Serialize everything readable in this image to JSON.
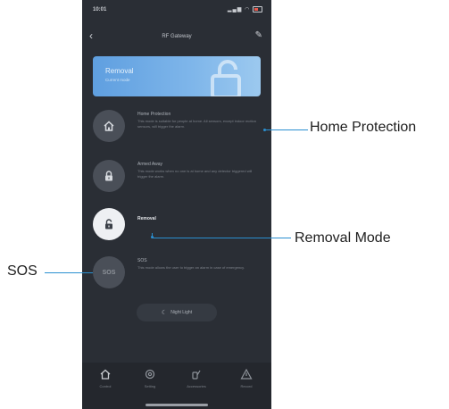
{
  "status_bar": {
    "time": "10:01"
  },
  "nav": {
    "title": "RF Gateway"
  },
  "banner": {
    "title": "Removal",
    "subtitle": "Current mode"
  },
  "modes": [
    {
      "title": "Home Protection",
      "description": "This mode is suitable for people at home. All sensors, except indoor motion sensors, will trigger the alarm."
    },
    {
      "title": "Armed Away",
      "description": "This mode works when no one is at home and any detector triggered will trigger the alarm."
    },
    {
      "title": "Removal",
      "description": ""
    },
    {
      "icon_text": "SOS",
      "title": "SOS",
      "description": "This mode allows the user to trigger an alarm in case of emergency."
    }
  ],
  "night_light": {
    "label": "Night Light"
  },
  "tabs": [
    {
      "label": "Control"
    },
    {
      "label": "Setting"
    },
    {
      "label": "Accessories"
    },
    {
      "label": "Record"
    }
  ],
  "callouts": {
    "home_protection": "Home Protection",
    "removal_mode": "Removal Mode",
    "sos": "SOS"
  },
  "colors": {
    "accent_line": "#2a8fd0",
    "banner": "#6aa8e4",
    "background": "#2a2e35"
  }
}
